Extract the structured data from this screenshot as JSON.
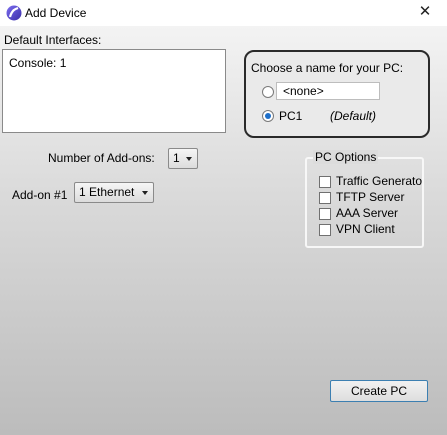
{
  "window": {
    "title": "Add Device",
    "close_glyph": "✕",
    "icon": "app-logo-icon",
    "accent_color": "#1e6fc9"
  },
  "interfaces": {
    "label": "Default Interfaces:",
    "lines": [
      "Console: 1"
    ]
  },
  "name_panel": {
    "label": "Choose a name for your PC:",
    "custom_value": "<none>",
    "custom_selected": false,
    "preset_label": "PC1",
    "preset_selected": true,
    "default_note": "(Default)"
  },
  "addons": {
    "count_label": "Number of Add-ons:",
    "count_value": "1",
    "addon1_label": "Add-on #1",
    "addon1_value": "1 Ethernet"
  },
  "pc_options": {
    "legend": "PC Options",
    "items": [
      {
        "label": "Traffic Generato",
        "checked": false
      },
      {
        "label": "TFTP Server",
        "checked": false
      },
      {
        "label": "AAA Server",
        "checked": false
      },
      {
        "label": "VPN Client",
        "checked": false
      }
    ]
  },
  "footer": {
    "create_label": "Create PC"
  }
}
